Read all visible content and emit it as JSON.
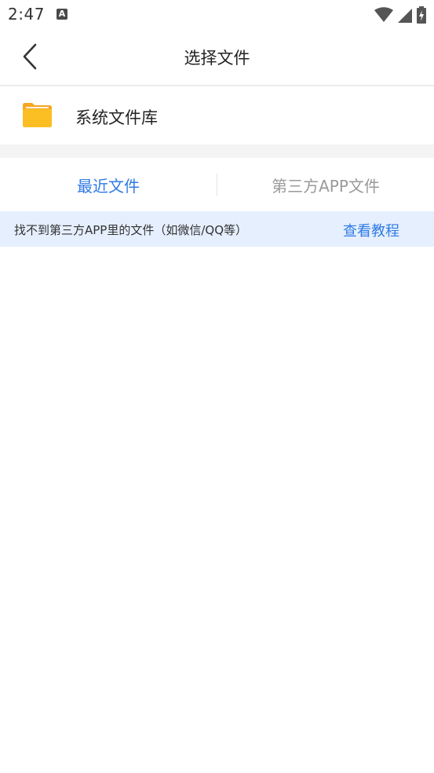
{
  "status_bar": {
    "time": "2:47",
    "notification_letter": "A",
    "icons": [
      "wifi-icon",
      "signal-icon",
      "battery-charging-icon"
    ]
  },
  "header": {
    "title": "选择文件",
    "back_icon": "chevron-left-icon"
  },
  "system_library": {
    "label": "系统文件库",
    "icon": "folder-icon",
    "folder_color": "#FBBF24"
  },
  "tabs": [
    {
      "label": "最近文件",
      "active": true
    },
    {
      "label": "第三方APP文件",
      "active": false
    }
  ],
  "notice": {
    "text": "找不到第三方APP里的文件（如微信/QQ等）",
    "link": "查看教程"
  },
  "colors": {
    "accent": "#2F7BE5",
    "notice_bg": "#E5EFFD",
    "inactive_tab": "#9A9A9A"
  }
}
